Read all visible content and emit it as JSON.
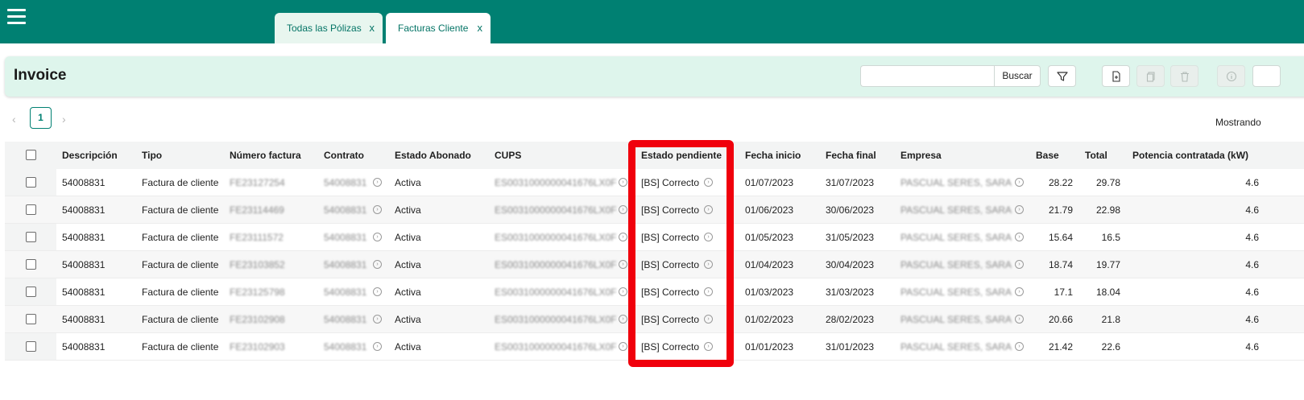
{
  "tabs": [
    {
      "label": "Todas las Pólizas",
      "close": "X"
    },
    {
      "label": "Facturas Cliente",
      "close": "X"
    }
  ],
  "header": {
    "title": "Invoice",
    "search_placeholder": "",
    "search_value": "",
    "search_button": "Buscar"
  },
  "pagination": {
    "current_page": "1",
    "prev": "‹",
    "next": "›",
    "showing_label": "Mostrando"
  },
  "columns": [
    "Descripción",
    "Tipo",
    "Número factura",
    "Contrato",
    "Estado Abonado",
    "CUPS",
    "Estado pendiente",
    "Fecha inicio",
    "Fecha final",
    "Empresa",
    "Base",
    "Total",
    "Potencia contratada (kW)"
  ],
  "rows": [
    {
      "descripcion": "54008831",
      "tipo": "Factura de cliente",
      "numero": "FE23127254",
      "contrato": "54008831",
      "estado_abonado": "Activa",
      "cups": "ES0031000000041676LX0F",
      "estado_pendiente": "[BS] Correcto",
      "fecha_inicio": "01/07/2023",
      "fecha_final": "31/07/2023",
      "empresa": "PASCUAL SERES, SARA",
      "base": "28.22",
      "total": "29.78",
      "potencia": "4.6"
    },
    {
      "descripcion": "54008831",
      "tipo": "Factura de cliente",
      "numero": "FE23114469",
      "contrato": "54008831",
      "estado_abonado": "Activa",
      "cups": "ES0031000000041676LX0F",
      "estado_pendiente": "[BS] Correcto",
      "fecha_inicio": "01/06/2023",
      "fecha_final": "30/06/2023",
      "empresa": "PASCUAL SERES, SARA",
      "base": "21.79",
      "total": "22.98",
      "potencia": "4.6"
    },
    {
      "descripcion": "54008831",
      "tipo": "Factura de cliente",
      "numero": "FE23111572",
      "contrato": "54008831",
      "estado_abonado": "Activa",
      "cups": "ES0031000000041676LX0F",
      "estado_pendiente": "[BS] Correcto",
      "fecha_inicio": "01/05/2023",
      "fecha_final": "31/05/2023",
      "empresa": "PASCUAL SERES, SARA",
      "base": "15.64",
      "total": "16.5",
      "potencia": "4.6"
    },
    {
      "descripcion": "54008831",
      "tipo": "Factura de cliente",
      "numero": "FE23103852",
      "contrato": "54008831",
      "estado_abonado": "Activa",
      "cups": "ES0031000000041676LX0F",
      "estado_pendiente": "[BS] Correcto",
      "fecha_inicio": "01/04/2023",
      "fecha_final": "30/04/2023",
      "empresa": "PASCUAL SERES, SARA",
      "base": "18.74",
      "total": "19.77",
      "potencia": "4.6"
    },
    {
      "descripcion": "54008831",
      "tipo": "Factura de cliente",
      "numero": "FE23125798",
      "contrato": "54008831",
      "estado_abonado": "Activa",
      "cups": "ES0031000000041676LX0F",
      "estado_pendiente": "[BS] Correcto",
      "fecha_inicio": "01/03/2023",
      "fecha_final": "31/03/2023",
      "empresa": "PASCUAL SERES, SARA",
      "base": "17.1",
      "total": "18.04",
      "potencia": "4.6"
    },
    {
      "descripcion": "54008831",
      "tipo": "Factura de cliente",
      "numero": "FE23102908",
      "contrato": "54008831",
      "estado_abonado": "Activa",
      "cups": "ES0031000000041676LX0F",
      "estado_pendiente": "[BS] Correcto",
      "fecha_inicio": "01/02/2023",
      "fecha_final": "28/02/2023",
      "empresa": "PASCUAL SERES, SARA",
      "base": "20.66",
      "total": "21.8",
      "potencia": "4.6"
    },
    {
      "descripcion": "54008831",
      "tipo": "Factura de cliente",
      "numero": "FE23102903",
      "contrato": "54008831",
      "estado_abonado": "Activa",
      "cups": "ES0031000000041676LX0F",
      "estado_pendiente": "[BS] Correcto",
      "fecha_inicio": "01/01/2023",
      "fecha_final": "31/01/2023",
      "empresa": "PASCUAL SERES, SARA",
      "base": "21.42",
      "total": "22.6",
      "potencia": "4.6"
    }
  ],
  "icons": {
    "menu": "hamburger-menu-icon",
    "filter": "filter-icon",
    "new": "new-document-icon",
    "copy": "copy-icon",
    "delete": "trash-icon",
    "info": "info-icon",
    "go": "go-arrow-icon"
  },
  "colors": {
    "topbar": "#008072",
    "card": "#def5ec",
    "highlight": "#f0000c",
    "accent_text": "#047466"
  }
}
